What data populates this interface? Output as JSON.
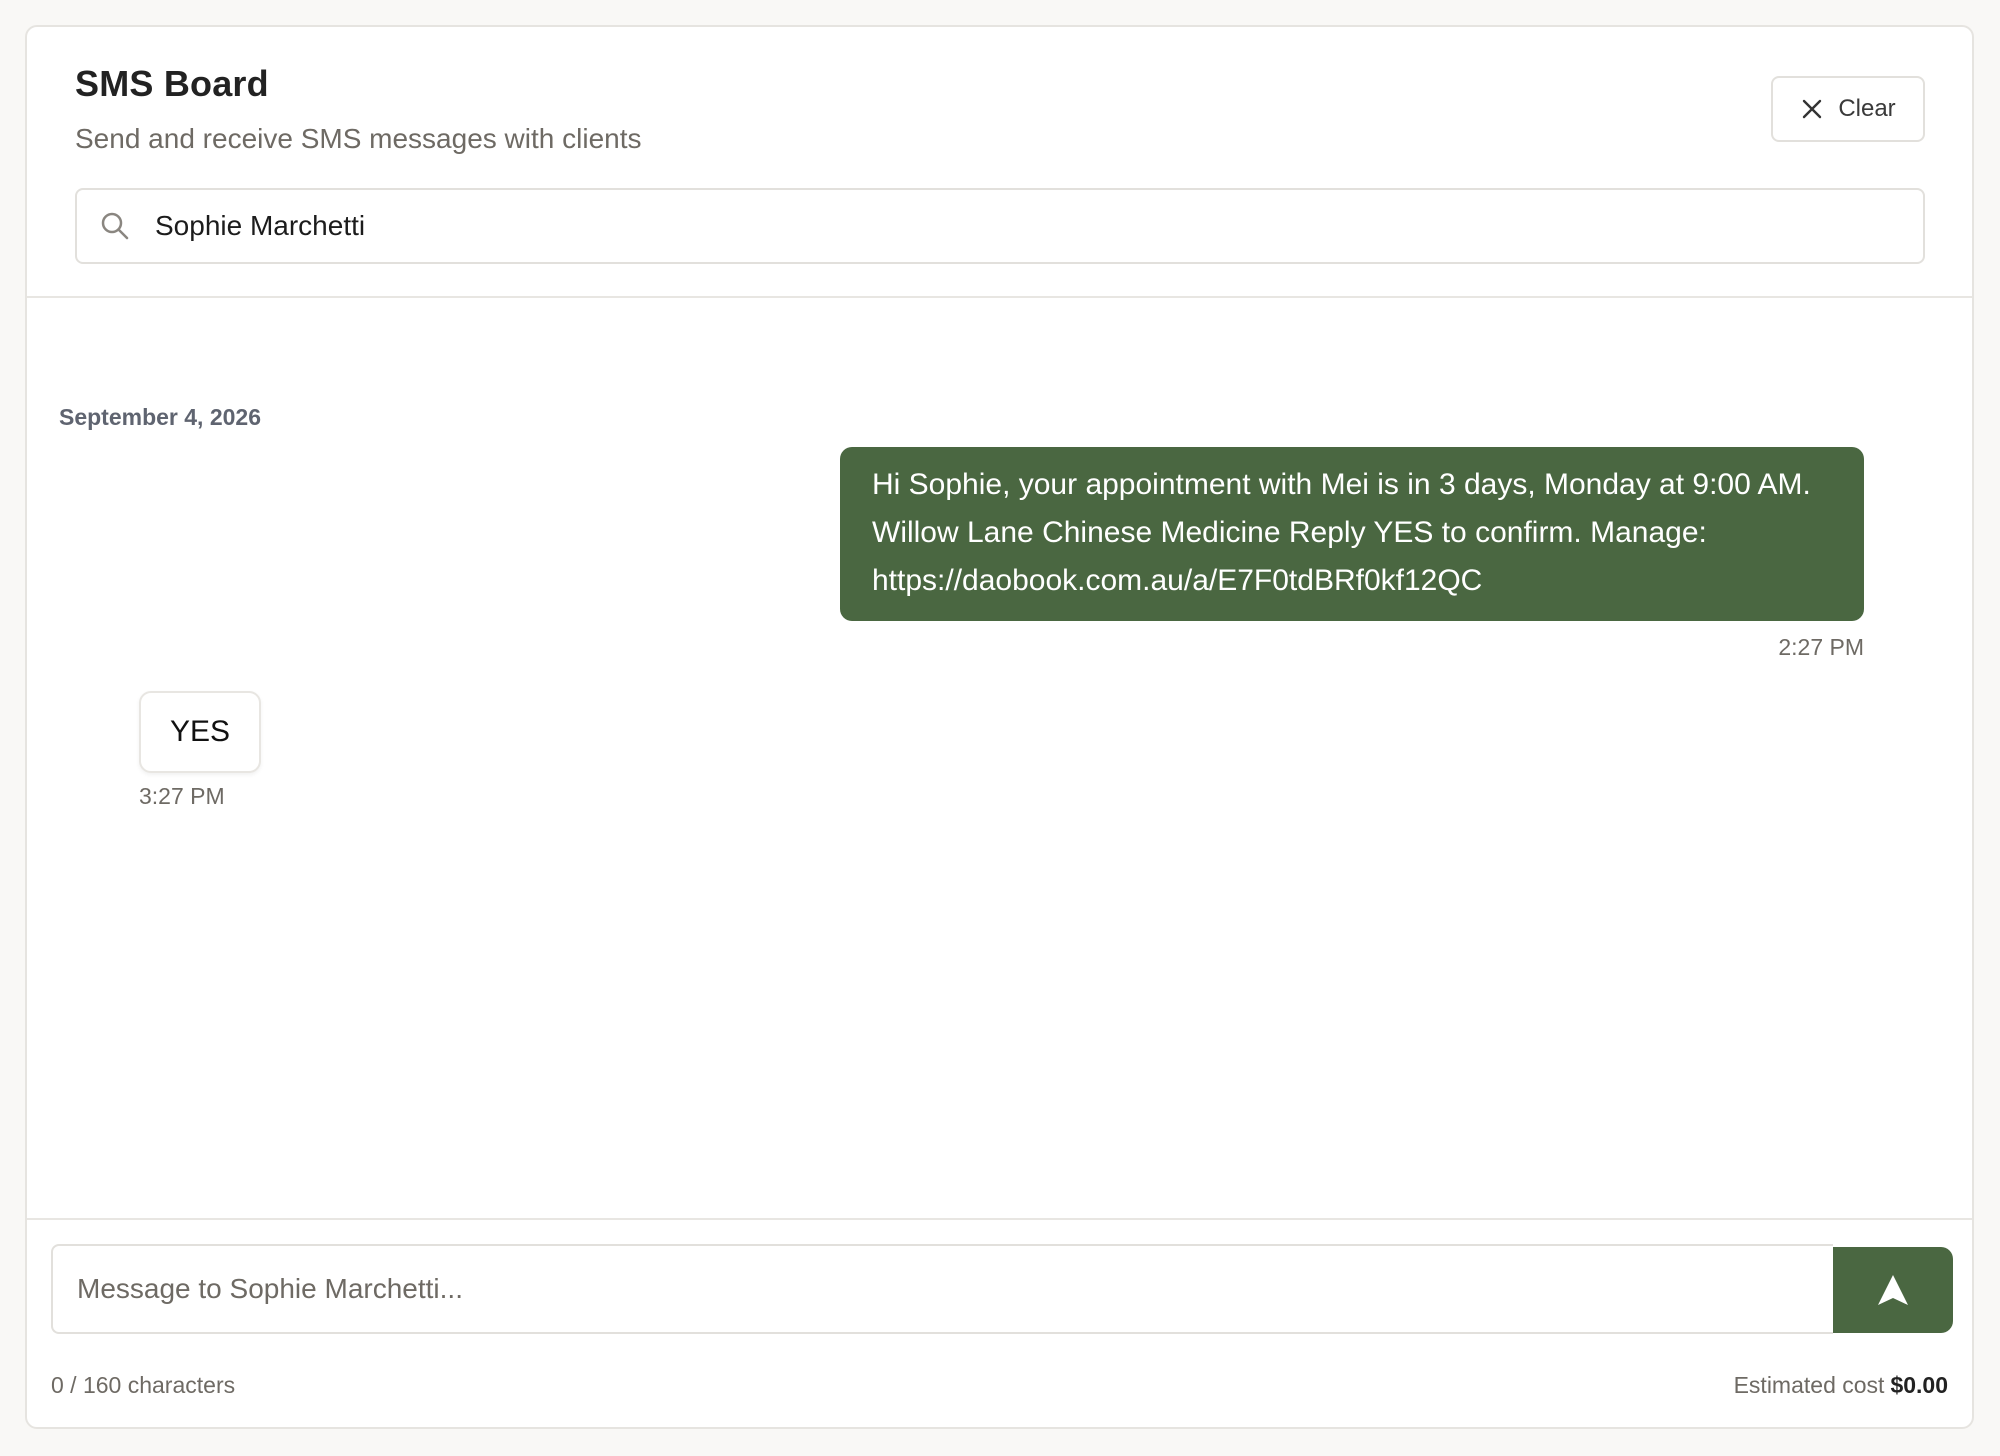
{
  "header": {
    "title": "SMS Board",
    "subtitle": "Send and receive SMS messages with clients",
    "clear_label": "Clear"
  },
  "search": {
    "value": "Sophie Marchetti"
  },
  "thread": {
    "date_separator": "September 4, 2026",
    "messages": [
      {
        "direction": "outgoing",
        "text": "Hi Sophie, your appointment with Mei is in 3 days, Monday at 9:00 AM. Willow Lane Chinese Medicine Reply YES to confirm. Manage: https://daobook.com.au/a/E7F0tdBRf0kf12QC",
        "time": "2:27 PM"
      },
      {
        "direction": "incoming",
        "text": "YES",
        "time": "3:27 PM"
      }
    ]
  },
  "composer": {
    "placeholder": "Message to Sophie Marchetti...",
    "char_count": "0 / 160 characters",
    "cost_label": "Estimated cost",
    "cost_value": "$0.00"
  },
  "colors": {
    "accent": "#4a6741",
    "background": "#f9f8f6",
    "muted_text": "#6e6a64"
  },
  "icons": {
    "clear": "close-icon",
    "search": "search-icon",
    "send": "send-icon"
  }
}
